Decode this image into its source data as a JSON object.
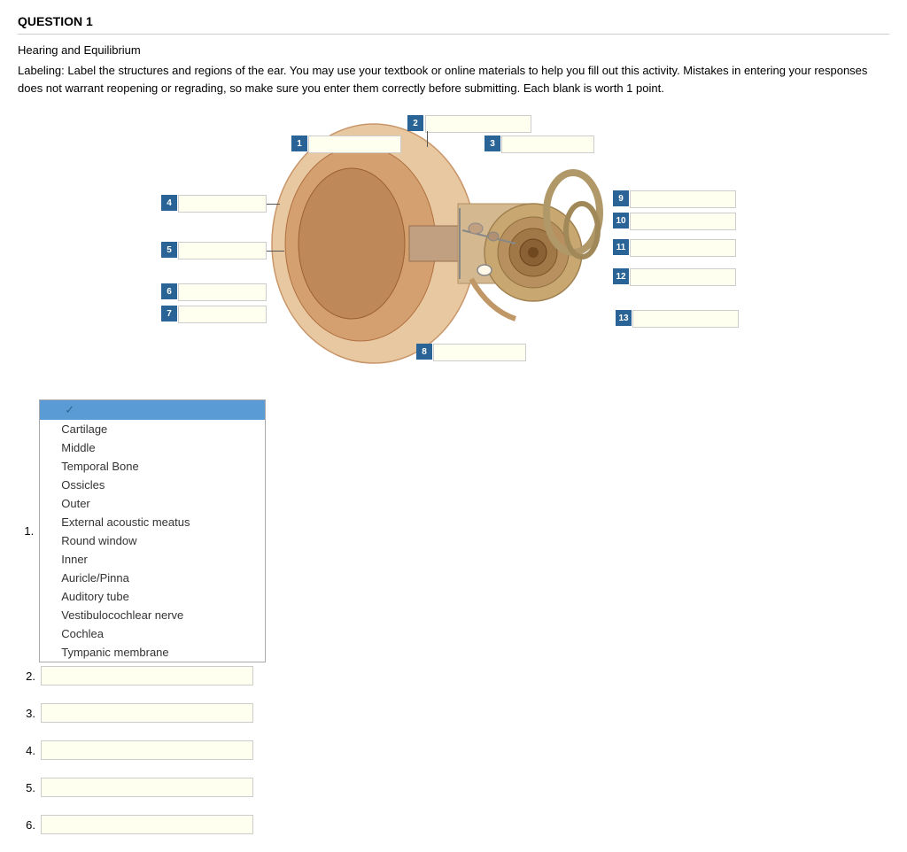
{
  "header": {
    "title": "QUESTION 1"
  },
  "subtitle": "Hearing and Equilibrium",
  "instructions": "Labeling: Label the structures and regions of the ear.  You may use your textbook or online materials to help you fill out this activity.  Mistakes in entering your responses does not warrant reopening or regrading, so make sure you enter them correctly before submitting. Each blank is worth 1 point.",
  "diagram": {
    "labels": [
      {
        "id": 1,
        "value": ""
      },
      {
        "id": 2,
        "value": ""
      },
      {
        "id": 3,
        "value": ""
      },
      {
        "id": 4,
        "value": ""
      },
      {
        "id": 5,
        "value": ""
      },
      {
        "id": 6,
        "value": ""
      },
      {
        "id": 7,
        "value": ""
      },
      {
        "id": 8,
        "value": ""
      },
      {
        "id": 9,
        "value": ""
      },
      {
        "id": 10,
        "value": ""
      },
      {
        "id": 11,
        "value": ""
      },
      {
        "id": 12,
        "value": ""
      },
      {
        "id": 13,
        "value": ""
      }
    ]
  },
  "dropdown": {
    "items": [
      {
        "label": "",
        "selected": true,
        "check": true
      },
      {
        "label": "Cartilage",
        "selected": false
      },
      {
        "label": "Middle",
        "selected": false
      },
      {
        "label": "Temporal Bone",
        "selected": false
      },
      {
        "label": "Ossicles",
        "selected": false
      },
      {
        "label": "Outer",
        "selected": false
      },
      {
        "label": "External acoustic meatus",
        "selected": false
      },
      {
        "label": "Round window",
        "selected": false
      },
      {
        "label": "Inner",
        "selected": false
      },
      {
        "label": "Auricle/Pinna",
        "selected": false
      },
      {
        "label": "Auditory tube",
        "selected": false
      },
      {
        "label": "Vestibulocochlear nerve",
        "selected": false
      },
      {
        "label": "Cochlea",
        "selected": false
      },
      {
        "label": "Tympanic membrane",
        "selected": false
      }
    ]
  },
  "questions": [
    {
      "num": "1.",
      "answer": ""
    },
    {
      "num": "2.",
      "answer": ""
    },
    {
      "num": "3.",
      "answer": ""
    },
    {
      "num": "4.",
      "answer": ""
    },
    {
      "num": "5.",
      "answer": ""
    },
    {
      "num": "6.",
      "answer": ""
    }
  ]
}
